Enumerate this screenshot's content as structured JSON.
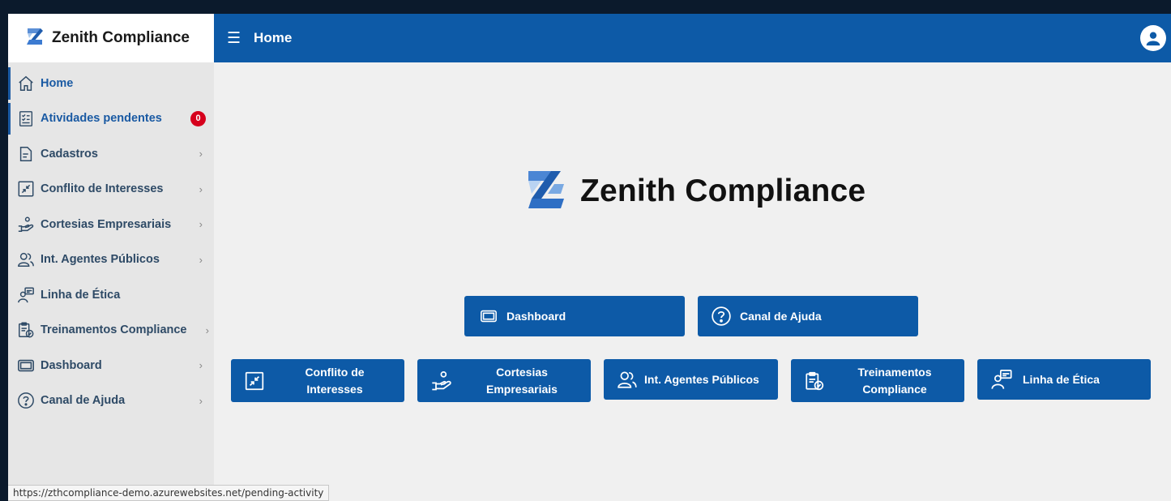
{
  "brand": {
    "name": "Zenith Compliance"
  },
  "topbar": {
    "title": "Home"
  },
  "sidebar": {
    "items": [
      {
        "label": "Home"
      },
      {
        "label": "Atividades pendentes",
        "badge": "0"
      },
      {
        "label": "Cadastros"
      },
      {
        "label": "Conflito de Interesses"
      },
      {
        "label": "Cortesias Empresariais"
      },
      {
        "label": "Int. Agentes Públicos"
      },
      {
        "label": "Linha de Ética"
      },
      {
        "label": "Treinamentos Compliance"
      },
      {
        "label": "Dashboard"
      },
      {
        "label": "Canal de Ajuda"
      }
    ]
  },
  "hero": {
    "title": "Zenith Compliance"
  },
  "shortcuts": {
    "dashboard": "Dashboard",
    "canal_ajuda": "Canal de Ajuda",
    "conflito_line1": "Conflito de",
    "conflito_line2": "Interesses",
    "cortesias_line1": "Cortesias",
    "cortesias_line2": "Empresariais",
    "agentes": "Int. Agentes Públicos",
    "treinamentos_line1": "Treinamentos",
    "treinamentos_line2": "Compliance",
    "linha_etica": "Linha de Ética"
  },
  "status": {
    "url": "https://zthcompliance-demo.azurewebsites.net/pending-activity"
  },
  "colors": {
    "primary": "#0d5aa7",
    "badge": "#d6001c",
    "sidebar_bg": "#e6e6e6",
    "content_bg": "#f0f0f0"
  }
}
